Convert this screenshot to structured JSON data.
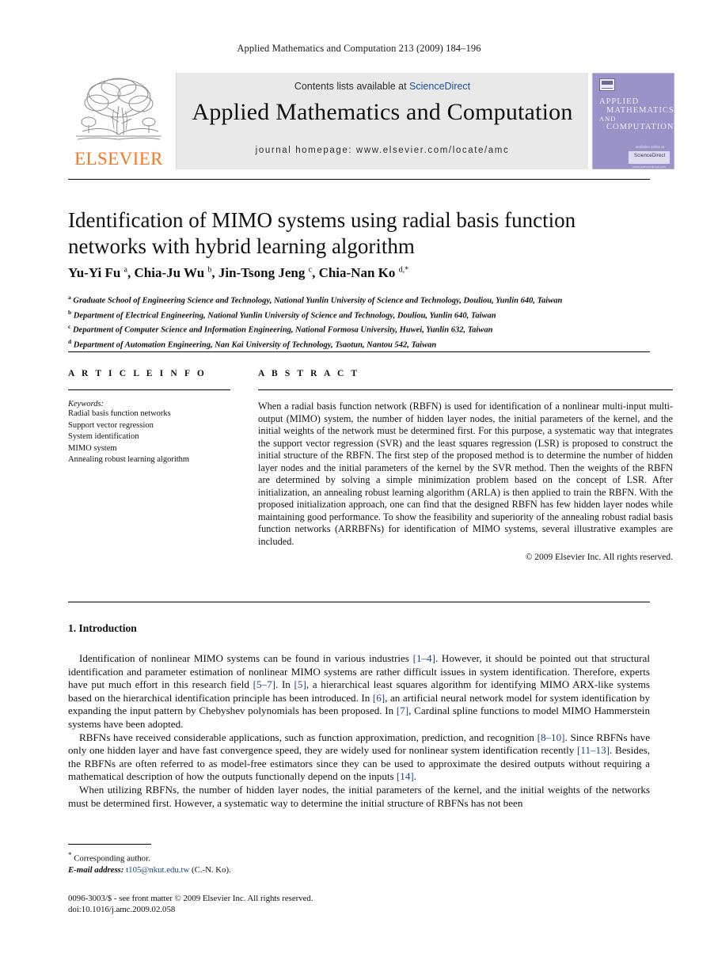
{
  "running_head": "Applied Mathematics and Computation 213 (2009) 184–196",
  "masthead": {
    "publisher_name": "ELSEVIER",
    "contents_prefix": "Contents lists available at ",
    "sciencedirect": "ScienceDirect",
    "journal_name": "Applied Mathematics and Computation",
    "homepage": "journal homepage: www.elsevier.com/locate/amc",
    "cover": {
      "line1": "APPLIED",
      "line2": "MATHEMATICS",
      "line3": "AND",
      "line4": "COMPUTATION",
      "badge_note": "available online at",
      "badge": "ScienceDirect",
      "badge_sub": "www.sciencedirect.com",
      "bg_color": "#9a93c8"
    }
  },
  "article": {
    "title": "Identification of MIMO systems using radial basis function networks with hybrid learning algorithm",
    "authors_html": "Yu-Yi Fu <sup>a</sup>, Chia-Ju Wu <sup>b</sup>, Jin-Tsong Jeng <sup>c</sup>, Chia-Nan Ko <sup>d,*</sup>",
    "affiliations": [
      "Graduate School of Engineering Science and Technology, National Yunlin University of Science and Technology, Douliou, Yunlin 640, Taiwan",
      "Department of Electrical Engineering, National Yunlin University of Science and Technology, Douliou, Yunlin 640, Taiwan",
      "Department of Computer Science and Information Engineering, National Formosa University, Huwei, Yunlin 632, Taiwan",
      "Department of Automation Engineering, Nan Kai University of Technology, Tsaotun, Nantou 542, Taiwan"
    ],
    "affiliation_marks": [
      "a",
      "b",
      "c",
      "d"
    ]
  },
  "info": {
    "heading": "A R T I C L E    I N F O",
    "keywords_label": "Keywords:",
    "keywords": [
      "Radial basis function networks",
      "Support vector regression",
      "System identification",
      "MIMO system",
      "Annealing robust learning algorithm"
    ]
  },
  "abstract": {
    "heading": "A B S T R A C T",
    "body": "When a radial basis function network (RBFN) is used for identification of a nonlinear multi-input multi-output (MIMO) system, the number of hidden layer nodes, the initial parameters of the kernel, and the initial weights of the network must be determined first. For this purpose, a systematic way that integrates the support vector regression (SVR) and the least squares regression (LSR) is proposed to construct the initial structure of the RBFN. The first step of the proposed method is to determine the number of hidden layer nodes and the initial parameters of the kernel by the SVR method. Then the weights of the RBFN are determined by solving a simple minimization problem based on the concept of LSR. After initialization, an annealing robust learning algorithm (ARLA) is then applied to train the RBFN. With the proposed initialization approach, one can find that the designed RBFN has few hidden layer nodes while maintaining good performance. To show the feasibility and superiority of the annealing robust radial basis function networks (ARRBFNs) for identification of MIMO systems, several illustrative examples are included.",
    "copyright": "© 2009 Elsevier Inc. All rights reserved."
  },
  "section": {
    "number_title": "1. Introduction",
    "paragraphs": [
      "Identification of nonlinear MIMO systems can be found in various industries <span class=\"ref\">[1–4]</span>. However, it should be pointed out that structural identification and parameter estimation of nonlinear MIMO systems are rather difficult issues in system identification. Therefore, experts have put much effort in this research field <span class=\"ref\">[5–7]</span>. In <span class=\"ref\">[5]</span>, a hierarchical least squares algorithm for identifying MIMO ARX-like systems based on the hierarchical identification principle has been introduced. In <span class=\"ref\">[6]</span>, an artificial neural network model for system identification by expanding the input pattern by Chebyshev polynomials has been proposed. In <span class=\"ref\">[7]</span>, Cardinal spline functions to model MIMO Hammerstein systems have been adopted.",
      "RBFNs have received considerable applications, such as function approximation, prediction, and recognition <span class=\"ref\">[8–10]</span>. Since RBFNs have only one hidden layer and have fast convergence speed, they are widely used for nonlinear system identification recently <span class=\"ref\">[11–13]</span>. Besides, the RBFNs are often referred to as model-free estimators since they can be used to approximate the desired outputs without requiring a mathematical description of how the outputs functionally depend on the inputs <span class=\"ref\">[14]</span>.",
      "When utilizing RBFNs, the number of hidden layer nodes, the initial parameters of the kernel, and the initial weights of the networks must be determined first. However, a systematic way to determine the initial structure of RBFNs has not been"
    ]
  },
  "footnotes": {
    "corresponding": "Corresponding author.",
    "corresponding_mark": "*",
    "email_label": "E-mail address:",
    "email": "t105@nkut.edu.tw",
    "email_owner": "(C.-N. Ko)."
  },
  "imprint": {
    "issn_line": "0096-3003/$ - see front matter © 2009 Elsevier Inc. All rights reserved.",
    "doi_line": "doi:10.1016/j.amc.2009.02.058"
  }
}
